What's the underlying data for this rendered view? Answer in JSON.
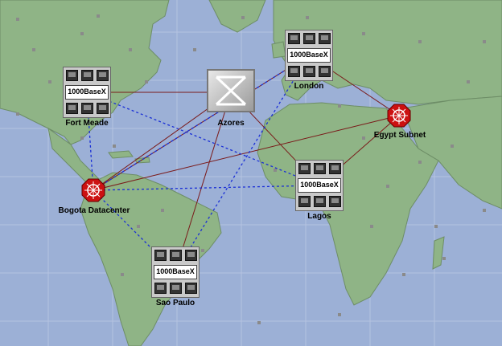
{
  "network": {
    "nodes": {
      "fort_meade": {
        "label": "Fort Meade",
        "type": "lan",
        "lan_label": "1000BaseX"
      },
      "azores": {
        "label": "Azores",
        "type": "switch"
      },
      "london": {
        "label": "London",
        "type": "lan",
        "lan_label": "1000BaseX"
      },
      "egypt": {
        "label": "Egypt Subnet",
        "type": "router"
      },
      "bogota": {
        "label": "Bogota Datacenter",
        "type": "router"
      },
      "lagos": {
        "label": "Lagos",
        "type": "lan",
        "lan_label": "1000BaseX"
      },
      "sao_paulo": {
        "label": "Sao Paulo",
        "type": "lan",
        "lan_label": "1000BaseX"
      }
    },
    "links_solid": [
      [
        "fort_meade",
        "azores"
      ],
      [
        "azores",
        "bogota"
      ],
      [
        "london",
        "bogota"
      ],
      [
        "egypt",
        "bogota"
      ],
      [
        "egypt",
        "lagos"
      ],
      [
        "egypt",
        "london"
      ],
      [
        "azores",
        "lagos"
      ],
      [
        "azores",
        "sao_paulo"
      ]
    ],
    "links_dashed": [
      [
        "fort_meade",
        "bogota"
      ],
      [
        "fort_meade",
        "lagos"
      ],
      [
        "bogota",
        "lagos"
      ],
      [
        "bogota",
        "sao_paulo"
      ],
      [
        "sao_paulo",
        "london"
      ],
      [
        "bogota",
        "london"
      ]
    ],
    "colors": {
      "ocean": "#9cb0d6",
      "land": "#8fb486",
      "solid_link": "#7a1a1a",
      "dashed_link": "#1a2fd6",
      "router": "#cc1111"
    }
  }
}
